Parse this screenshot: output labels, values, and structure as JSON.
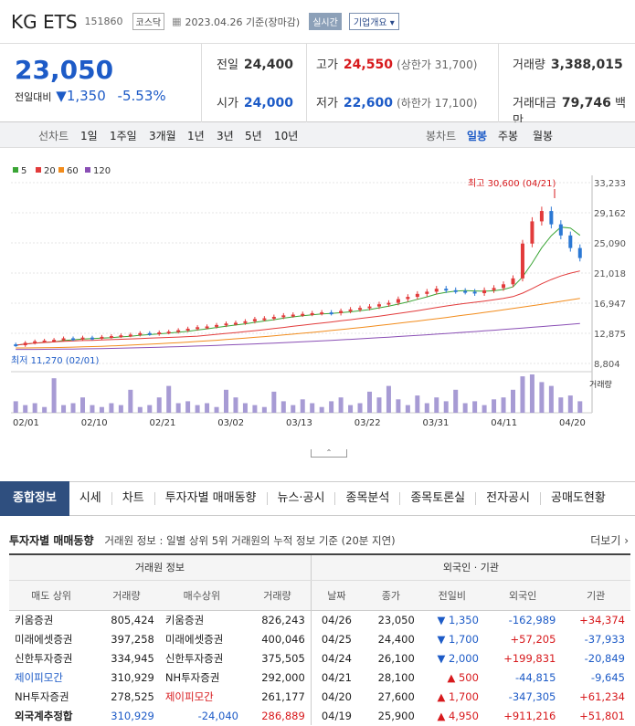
{
  "header": {
    "name": "KG ETS",
    "code": "151860",
    "market": "코스닥",
    "date": "2023.04.26 기준(장마감)",
    "realtime": "실시간",
    "overview": "기업개요 ▾"
  },
  "summary": {
    "price": "23,050",
    "diff_label": "전일대비",
    "diff_value": "1,350",
    "diff_pct": "-5.53%",
    "prev_label": "전일",
    "prev": "24,400",
    "high_label": "고가",
    "high": "24,550",
    "upper": "(상한가 31,700)",
    "vol_label": "거래량",
    "vol": "3,388,015",
    "open_label": "시가",
    "open": "24,000",
    "low_label": "저가",
    "low": "22,600",
    "lower": "(하한가 17,100)",
    "amt_label": "거래대금",
    "amt": "79,746",
    "amt_unit": "백만"
  },
  "period": {
    "label": "선차트",
    "items": [
      "1일",
      "1주일",
      "3개월",
      "1년",
      "3년",
      "5년",
      "10년"
    ],
    "candle_label": "봉차트",
    "candle_items": [
      "일봉",
      "주봉",
      "월봉"
    ]
  },
  "chart_data": {
    "type": "candlestick",
    "legend": [
      "5",
      "20",
      "60",
      "120"
    ],
    "colors": [
      "#3aa535",
      "#e23b3b",
      "#f28c1c",
      "#8a4fb5"
    ],
    "y_ticks": [
      "33,233",
      "29,162",
      "25,090",
      "21,018",
      "16,947",
      "12,875",
      "8,804"
    ],
    "ylim": [
      8804,
      33233
    ],
    "x_ticks": [
      "02/01",
      "02/10",
      "02/21",
      "03/02",
      "03/13",
      "03/22",
      "03/31",
      "04/11",
      "04/20"
    ],
    "high_note": "최고 30,600 (04/21)",
    "low_note": "최저 11,270 (02/01)",
    "vol_label": "거래량",
    "closes": [
      11270,
      11600,
      11800,
      11900,
      12000,
      12200,
      12100,
      12300,
      12200,
      12400,
      12500,
      12600,
      12700,
      12900,
      12800,
      13000,
      13100,
      13300,
      13500,
      13700,
      13800,
      14000,
      14200,
      14300,
      14500,
      14800,
      14900,
      15100,
      15300,
      15400,
      15500,
      15600,
      15700,
      15600,
      15900,
      16100,
      16300,
      16500,
      16800,
      17000,
      17500,
      17800,
      18200,
      18500,
      18900,
      18700,
      18600,
      18500,
      18300,
      18700,
      19000,
      19500,
      20300,
      25000,
      28000,
      29400,
      27600,
      26100,
      24400,
      23050
    ],
    "volumes": [
      30,
      20,
      25,
      15,
      90,
      20,
      25,
      40,
      20,
      15,
      25,
      20,
      60,
      15,
      20,
      40,
      70,
      25,
      30,
      20,
      25,
      15,
      60,
      40,
      25,
      20,
      15,
      55,
      30,
      20,
      35,
      25,
      15,
      30,
      40,
      20,
      25,
      55,
      40,
      70,
      35,
      20,
      45,
      25,
      40,
      30,
      60,
      25,
      30,
      20,
      35,
      40,
      60,
      95,
      100,
      80,
      70,
      40,
      45,
      30
    ]
  },
  "tabs": [
    "종합정보",
    "시세",
    "차트",
    "투자자별 매매동향",
    "뉴스·공시",
    "종목분석",
    "종목토론실",
    "전자공시",
    "공매도현황"
  ],
  "investor": {
    "title": "투자자별 매매동향",
    "desc": "거래원 정보 : 일별 상위 5위 거래원의 누적 정보 기준 (20분 지연)",
    "more": "더보기 ›",
    "g1": "거래원 정보",
    "g2": "외국인 · 기관",
    "cols": [
      "매도 상위",
      "거래량",
      "매수상위",
      "거래량",
      "날짜",
      "종가",
      "전일비",
      "외국인",
      "기관"
    ],
    "rows": [
      [
        "키움증권",
        "805,424",
        "키움증권",
        "826,243",
        "04/26",
        "23,050",
        "▼ 1,350",
        "-162,989",
        "+34,374"
      ],
      [
        "미래에셋증권",
        "397,258",
        "미래에셋증권",
        "400,046",
        "04/25",
        "24,400",
        "▼ 1,700",
        "+57,205",
        "-37,933"
      ],
      [
        "신한투자증권",
        "334,945",
        "신한투자증권",
        "375,505",
        "04/24",
        "26,100",
        "▼ 2,000",
        "+199,831",
        "-20,849"
      ],
      [
        "제이피모간",
        "310,929",
        "NH투자증권",
        "292,000",
        "04/21",
        "28,100",
        "▲ 500",
        "-44,815",
        "-9,645"
      ],
      [
        "NH투자증권",
        "278,525",
        "제이피모간",
        "261,177",
        "04/20",
        "27,600",
        "▲ 1,700",
        "-347,305",
        "+61,234"
      ],
      [
        "외국계추정합",
        "310,929",
        "-24,040",
        "286,889",
        "04/19",
        "25,900",
        "▲ 4,950",
        "+911,216",
        "+51,801"
      ]
    ]
  }
}
